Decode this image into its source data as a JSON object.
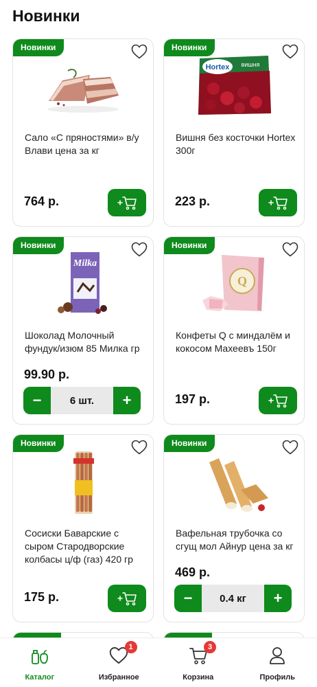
{
  "header": {
    "title": "Новинки"
  },
  "products": [
    {
      "badge": "Новинки",
      "name": "Сало «С пряностями» в/у Влави цена за кг",
      "price": "764 р.",
      "image": "salo"
    },
    {
      "badge": "Новинки",
      "name": "Вишня без косточки Hortex 300г",
      "price": "223 р.",
      "image": "cherry-pack",
      "image_brand": "Hortex",
      "image_caption": "вишня"
    },
    {
      "badge": "Новинки",
      "name": "Шоколад Молочный фундук/изюм 85 Милка гр",
      "price": "99.90 р.",
      "image": "milka-bar",
      "image_brand": "Milka",
      "quantity": "6 шт."
    },
    {
      "badge": "Новинки",
      "name": "Конфеты Q с миндалём и кокосом Махеевъ 150г",
      "price": "197 р.",
      "image": "candy-box"
    },
    {
      "badge": "Новинки",
      "name": "Сосиски Баварские с сыром Стародворские колбасы ц/ф (газ) 420 гр",
      "price": "175 р.",
      "image": "sausages"
    },
    {
      "badge": "Новинки",
      "name": "Вафельная трубочка со сгущ мол Айнур цена за кг",
      "price": "469 р.",
      "image": "wafer-rolls",
      "quantity": "0.4 кг"
    }
  ],
  "tabbar": {
    "tabs": [
      {
        "label": "Каталог",
        "icon": "catalog-icon",
        "active": true
      },
      {
        "label": "Избранное",
        "icon": "heart-icon",
        "badge": "1"
      },
      {
        "label": "Корзина",
        "icon": "cart-icon",
        "badge": "3"
      },
      {
        "label": "Профиль",
        "icon": "profile-icon"
      }
    ]
  },
  "colors": {
    "accent": "#0f8a1c",
    "badge_red": "#e53935"
  }
}
